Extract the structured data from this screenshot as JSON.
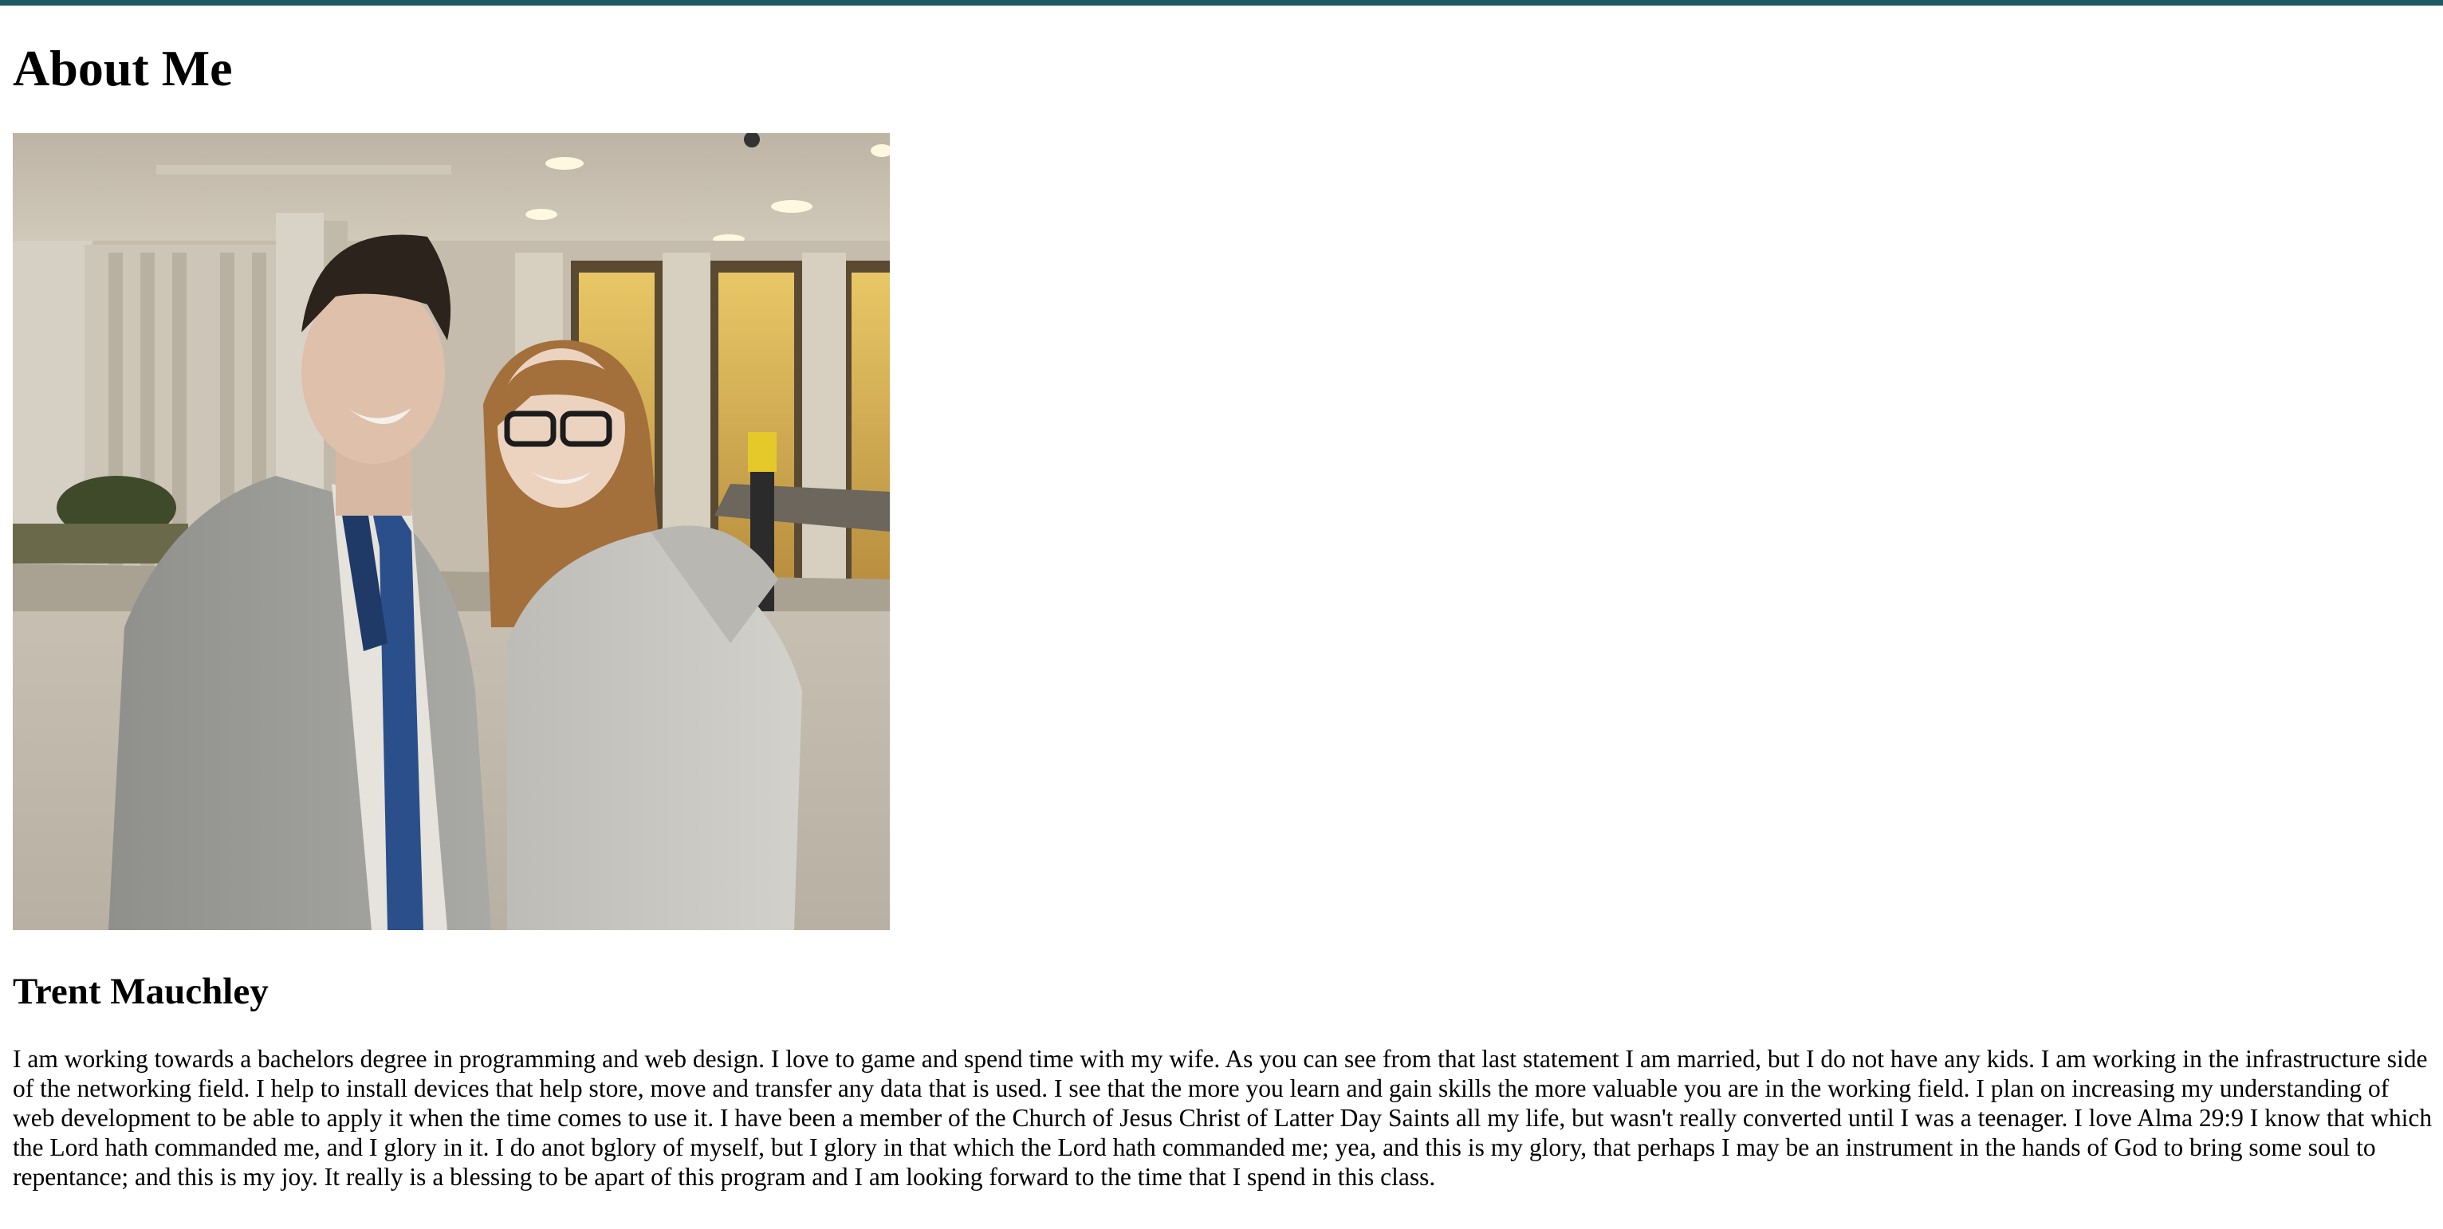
{
  "page": {
    "title": "About Me",
    "accent_color": "#1e5a63"
  },
  "photo": {
    "alt": "Trent Mauchley",
    "icon": "couple-photo"
  },
  "profile": {
    "name": "Trent Mauchley",
    "bio": "I am working towards a bachelors degree in programming and web design. I love to game and spend time with my wife. As you can see from that last statement I am married, but I do not have any kids. I am working in the infrastructure side of the networking field. I help to install devices that help store, move and transfer any data that is used. I see that the more you learn and gain skills the more valuable you are in the working field. I plan on increasing my understanding of web development to be able to apply it when the time comes to use it. I have been a member of the Church of Jesus Christ of Latter Day Saints all my life, but wasn't really converted until I was a teenager. I love Alma 29:9 I know that which the Lord hath commanded me, and I glory in it. I do anot bglory of myself, but I glory in that which the Lord hath commanded me; yea, and this is my glory, that perhaps I may be an instrument in the hands of God to bring some soul to repentance; and this is my joy. It really is a blessing to be apart of this program and I am looking forward to the time that I spend in this class."
  }
}
